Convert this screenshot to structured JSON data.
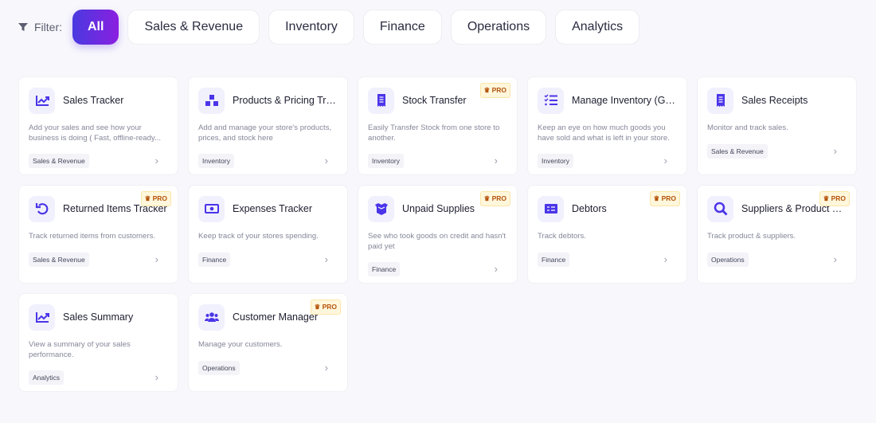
{
  "filter": {
    "label": "Filter:",
    "options": [
      "All",
      "Sales & Revenue",
      "Inventory",
      "Finance",
      "Operations",
      "Analytics"
    ],
    "active": "All"
  },
  "pro_label": "PRO",
  "colors": {
    "accent": "#4f3ae0",
    "gradient_end": "#8a1fe0",
    "pro_bg": "#fff7dc",
    "pro_text": "#b5540c"
  },
  "cards": [
    {
      "title": "Sales Tracker",
      "desc": "Add your sales and see how your business is doing ( Fast, offline-ready...",
      "tag": "Sales & Revenue",
      "icon": "trending-up-icon",
      "pro": false
    },
    {
      "title": "Products & Pricing Trac...",
      "desc": "Add and manage your store's products, prices, and stock here",
      "tag": "Inventory",
      "icon": "boxes-icon",
      "pro": false
    },
    {
      "title": "Stock Transfer",
      "desc": "Easily Transfer Stock from one store to another.",
      "tag": "Inventory",
      "icon": "receipt-icon",
      "pro": true
    },
    {
      "title": "Manage Inventory (Go...",
      "desc": "Keep an eye on how much goods you have sold and what is left in your store.",
      "tag": "Inventory",
      "icon": "checklist-icon",
      "pro": false
    },
    {
      "title": "Sales Receipts",
      "desc": "Monitor and track sales.",
      "tag": "Sales & Revenue",
      "icon": "receipt-icon",
      "pro": false
    },
    {
      "title": "Returned Items Tracker",
      "desc": "Track returned items from customers.",
      "tag": "Sales & Revenue",
      "icon": "undo-icon",
      "pro": true
    },
    {
      "title": "Expenses Tracker",
      "desc": "Keep track of your stores spending.",
      "tag": "Finance",
      "icon": "money-icon",
      "pro": false
    },
    {
      "title": "Unpaid Supplies",
      "desc": "See who took goods on credit and hasn't paid yet",
      "tag": "Finance",
      "icon": "box-open-icon",
      "pro": true
    },
    {
      "title": "Debtors",
      "desc": "Track debtors.",
      "tag": "Finance",
      "icon": "bill-icon",
      "pro": true
    },
    {
      "title": "Suppliers & Product Tr...",
      "desc": "Track product & suppliers.",
      "tag": "Operations",
      "icon": "search-icon",
      "pro": true
    },
    {
      "title": "Sales Summary",
      "desc": "View a summary of your sales performance.",
      "tag": "Analytics",
      "icon": "trending-up-icon",
      "pro": false
    },
    {
      "title": "Customer Manager",
      "desc": "Manage your customers.",
      "tag": "Operations",
      "icon": "users-icon",
      "pro": true
    }
  ]
}
